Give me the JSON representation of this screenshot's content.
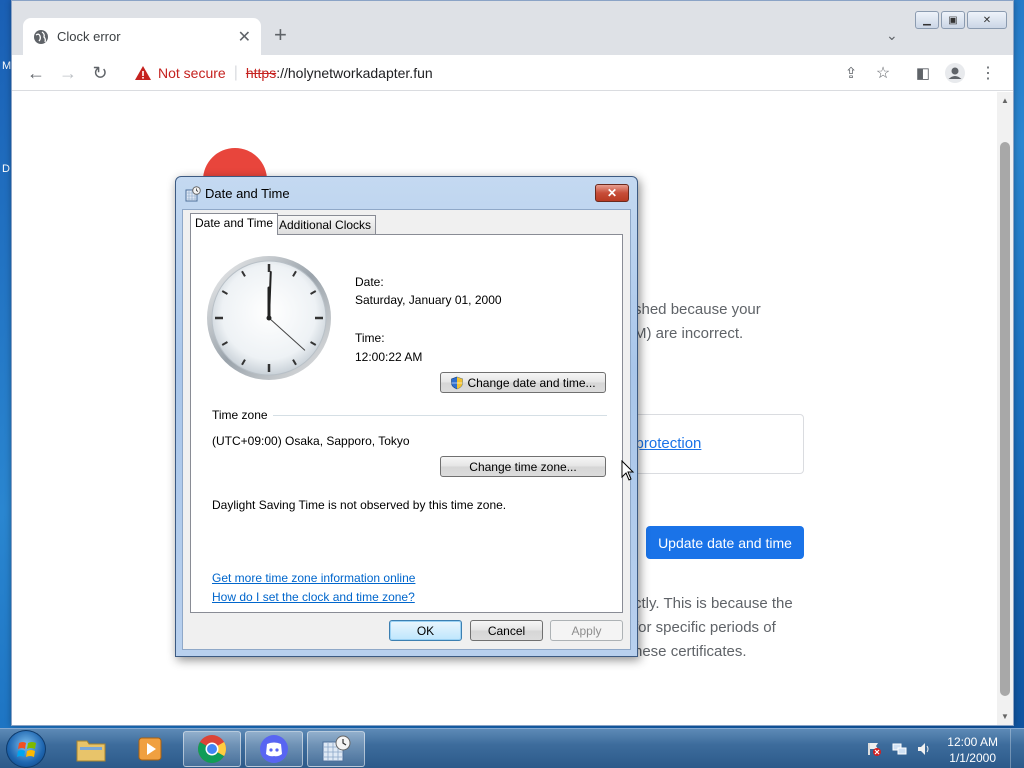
{
  "browser": {
    "tab_title": "Clock error",
    "new_tab_symbol": "+",
    "url_warning": "Not secure",
    "url_scheme": "https",
    "url_host": "://holynetworkadapter.fun"
  },
  "page": {
    "text_line1": "shed because your",
    "text_line2": "M) are incorrect.",
    "protection_link": "d protection",
    "update_button": "Update date and time",
    "para_line1": "ctly. This is because the",
    "para_line2": "for specific periods of",
    "para_line3": "hese certificates."
  },
  "dialog": {
    "title": "Date and Time",
    "tabs": [
      "Date and Time",
      "Additional Clocks"
    ],
    "date_label": "Date:",
    "date_value": "Saturday, January 01, 2000",
    "time_label": "Time:",
    "time_value": "12:00:22 AM",
    "change_datetime_button": "Change date and time...",
    "timezone_heading": "Time zone",
    "timezone_value": "(UTC+09:00) Osaka, Sapporo, Tokyo",
    "change_timezone_button": "Change time zone...",
    "dst_note": "Daylight Saving Time is not observed by this time zone.",
    "link_more_info": "Get more time zone information online",
    "link_how_to": "How do I set the clock and time zone?",
    "ok_button": "OK",
    "cancel_button": "Cancel",
    "apply_button": "Apply",
    "clock": {
      "hours": 12,
      "minutes": 0,
      "seconds": 22
    }
  },
  "taskbar": {
    "clock_time": "12:00 AM",
    "clock_date": "1/1/2000"
  },
  "colors": {
    "accent": "#1a73e8",
    "error_red": "#e8453c",
    "warning_red": "#c5221f"
  }
}
